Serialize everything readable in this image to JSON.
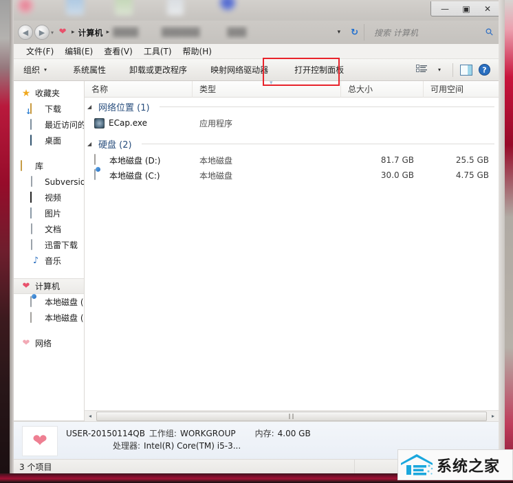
{
  "window": {
    "controls": {
      "minimize": "—",
      "restore": "▣",
      "close": "✕"
    }
  },
  "addressbar": {
    "back_icon": "◀",
    "forward_icon": "▶",
    "history_caret": "▾",
    "crumb_root_icon": "heart-icon",
    "crumbs": [
      {
        "label": "计算机",
        "current": true
      }
    ],
    "separator": "▸",
    "dropdown_caret": "▾",
    "refresh_icon": "↻",
    "search_placeholder": "搜索 计算机",
    "search_icon": "search-icon"
  },
  "menubar": {
    "items": [
      "文件(F)",
      "编辑(E)",
      "查看(V)",
      "工具(T)",
      "帮助(H)"
    ]
  },
  "toolbar": {
    "organize": "组织",
    "organize_caret": "▾",
    "buttons": [
      "系统属性",
      "卸载或更改程序",
      "映射网络驱动器",
      "打开控制面板"
    ],
    "highlighted_button": "打开控制面板",
    "view_caret": "▾",
    "icons": [
      "view-layout-icon",
      "preview-pane-icon",
      "help-icon"
    ]
  },
  "navpane": {
    "groups": [
      {
        "header": {
          "label": "收藏夹",
          "icon": "star-icon"
        },
        "items": [
          {
            "label": "下载",
            "icon": "downloads-icon"
          },
          {
            "label": "最近访问的",
            "icon": "recent-places-icon"
          },
          {
            "label": "桌面",
            "icon": "desktop-icon"
          }
        ]
      },
      {
        "header": {
          "label": "库",
          "icon": "library-icon"
        },
        "items": [
          {
            "label": "Subversion",
            "icon": "document-icon"
          },
          {
            "label": "视频",
            "icon": "video-icon"
          },
          {
            "label": "图片",
            "icon": "pictures-icon"
          },
          {
            "label": "文档",
            "icon": "documents-icon"
          },
          {
            "label": "迅雷下载",
            "icon": "thunder-download-icon"
          },
          {
            "label": "音乐",
            "icon": "music-icon"
          }
        ]
      },
      {
        "header": {
          "label": "计算机",
          "icon": "computer-heart-icon",
          "selected": true
        },
        "items": [
          {
            "label": "本地磁盘 (",
            "icon": "windows-drive-icon"
          },
          {
            "label": "本地磁盘 (",
            "icon": "drive-icon"
          }
        ]
      },
      {
        "header": {
          "label": "网络",
          "icon": "network-heart-icon"
        },
        "items": []
      }
    ]
  },
  "listpane": {
    "columns": [
      "名称",
      "类型",
      "总大小",
      "可用空间"
    ],
    "sort_indicator": "▾",
    "group_collapse_icon": "◢",
    "groups": [
      {
        "title": "网络位置 (1)",
        "rows": [
          {
            "name": "ECap.exe",
            "icon": "exe-icon",
            "type": "应用程序",
            "size": "",
            "free": ""
          }
        ]
      },
      {
        "title": "硬盘 (2)",
        "rows": [
          {
            "name": "本地磁盘 (D:)",
            "icon": "drive-icon",
            "type": "本地磁盘",
            "size": "81.7 GB",
            "free": "25.5 GB"
          },
          {
            "name": "本地磁盘 (C:)",
            "icon": "windows-drive-icon",
            "type": "本地磁盘",
            "size": "30.0 GB",
            "free": "4.75 GB"
          }
        ]
      }
    ]
  },
  "scrollbar": {
    "left_arrow": "◂",
    "right_arrow": "▸",
    "grip": "‖‖"
  },
  "details": {
    "icon": "computer-heart-icon",
    "computer_name": "USER-20150114QB",
    "workgroup_key": "工作组:",
    "workgroup_value": "WORKGROUP",
    "memory_key": "内存:",
    "memory_value": "4.00 GB",
    "processor_key": "处理器:",
    "processor_value": "Intel(R) Core(TM) i5-3..."
  },
  "statusbar": {
    "item_count": "3 个项目"
  },
  "watermark": {
    "text": "系统之家",
    "logo": "house-e-logo"
  },
  "colors": {
    "accent_blue": "#2a6fc0",
    "annotation_red": "#e8222a",
    "group_title": "#2a4f7e",
    "frame_red": "#b01434",
    "watermark_blue": "#1aa7dd"
  }
}
